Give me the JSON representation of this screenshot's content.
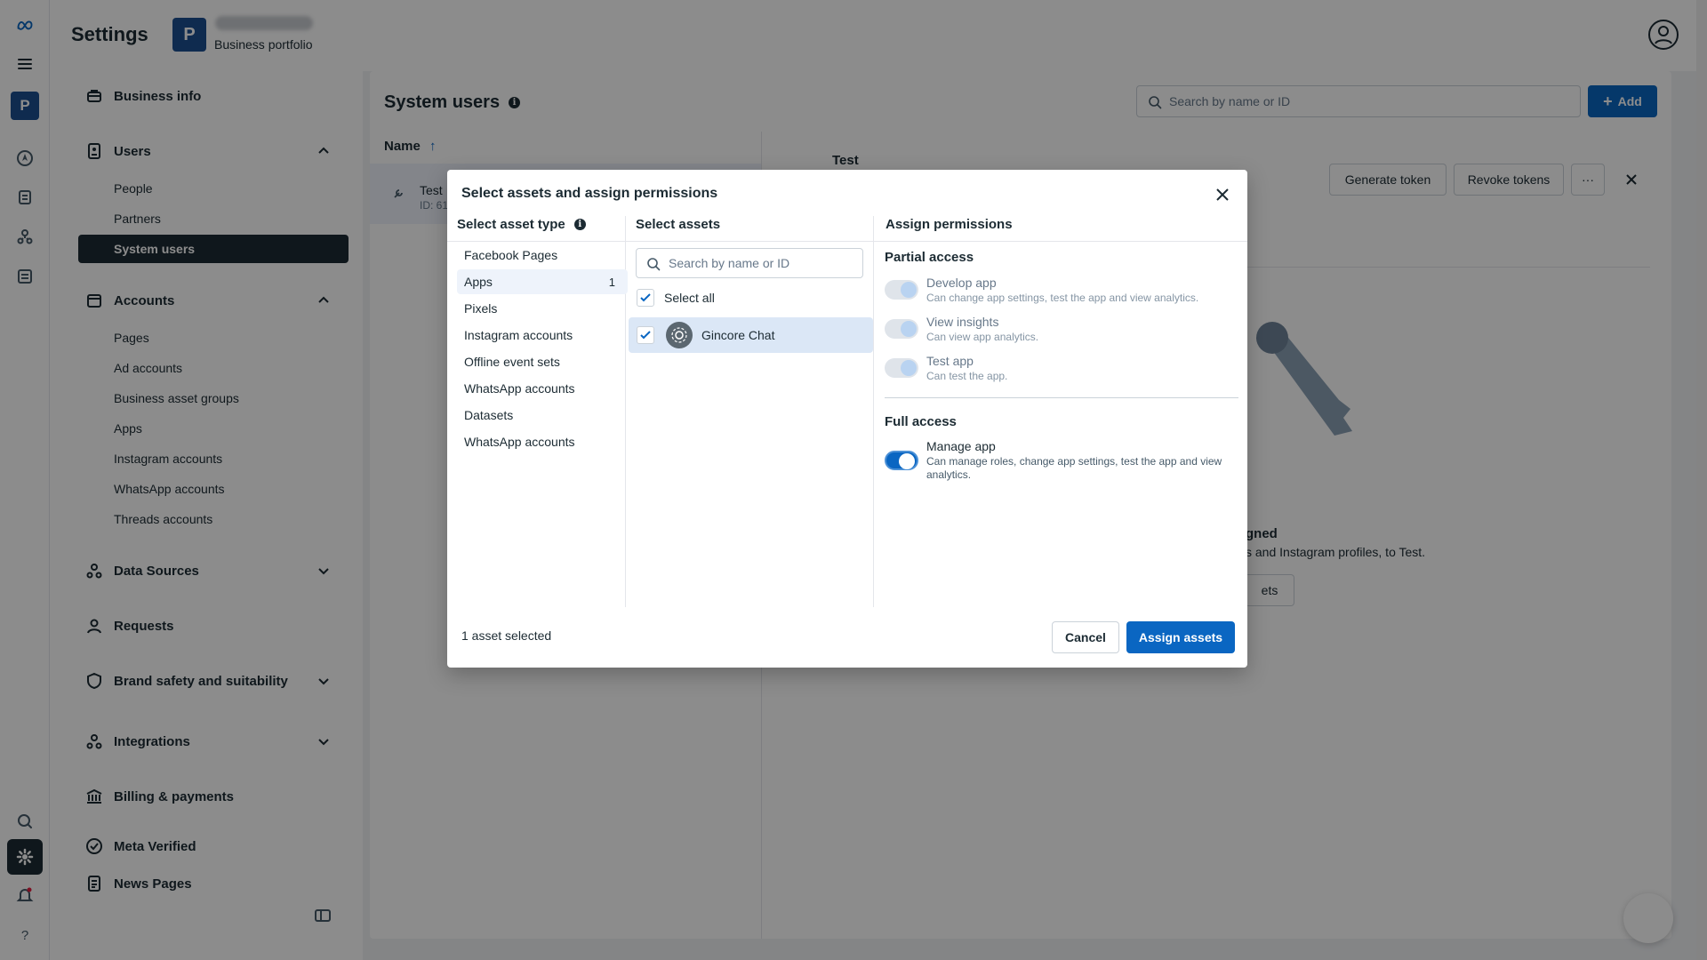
{
  "app": {
    "title": "Settings",
    "portfolio_initial": "P",
    "portfolio_label": "Business portfolio"
  },
  "rail": {
    "badge": "P",
    "items": [
      "meta-logo-icon",
      "menu-icon",
      "compass-icon",
      "pages-icon",
      "network-icon",
      "billing-icon",
      "search-icon",
      "gear-icon",
      "bell-icon",
      "help-icon"
    ]
  },
  "sidebar": {
    "business_info": "Business info",
    "users": "Users",
    "users_items": [
      "People",
      "Partners",
      "System users"
    ],
    "accounts": "Accounts",
    "accounts_items": [
      "Pages",
      "Ad accounts",
      "Business asset groups",
      "Apps",
      "Instagram accounts",
      "WhatsApp accounts",
      "Threads accounts"
    ],
    "data_sources": "Data Sources",
    "requests": "Requests",
    "brand_safety": "Brand safety and suitability",
    "integrations": "Integrations",
    "billing": "Billing & payments",
    "meta_verified": "Meta Verified",
    "news_pages": "News Pages"
  },
  "content": {
    "section_title": "System users",
    "search_placeholder": "Search by name or ID",
    "add_label": "Add",
    "col_name": "Name",
    "user_name": "Test",
    "user_id": "ID: 61",
    "detail_title": "Test",
    "generate_token": "Generate token",
    "revoke_tokens": "Revoke tokens",
    "more": "···",
    "empty_title": "gned",
    "empty_text": "s and Instagram profiles, to Test.",
    "empty_btn": "ets"
  },
  "modal": {
    "title": "Select assets and assign permissions",
    "col_asset_type": "Select asset type",
    "col_assets": "Select assets",
    "col_permissions": "Assign permissions",
    "asset_types": [
      {
        "label": "Facebook Pages",
        "count": ""
      },
      {
        "label": "Apps",
        "count": "1"
      },
      {
        "label": "Pixels",
        "count": ""
      },
      {
        "label": "Instagram accounts",
        "count": ""
      },
      {
        "label": "Offline event sets",
        "count": ""
      },
      {
        "label": "WhatsApp accounts",
        "count": ""
      },
      {
        "label": "Datasets",
        "count": ""
      },
      {
        "label": "WhatsApp accounts",
        "count": ""
      }
    ],
    "asset_search_placeholder": "Search by name or ID",
    "select_all": "Select all",
    "asset_name": "Gincore Chat",
    "partial_access": "Partial access",
    "full_access": "Full access",
    "perms": {
      "develop": {
        "name": "Develop app",
        "desc": "Can change app settings, test the app and view analytics.",
        "on": false
      },
      "insights": {
        "name": "View insights",
        "desc": "Can view app analytics.",
        "on": false
      },
      "test": {
        "name": "Test app",
        "desc": "Can test the app.",
        "on": false
      },
      "manage": {
        "name": "Manage app",
        "desc": "Can manage roles, change app settings, test the app and view analytics.",
        "on": true
      }
    },
    "footer_text": "1 asset selected",
    "cancel": "Cancel",
    "assign": "Assign assets"
  },
  "colors": {
    "primary": "#0a66c2",
    "text": "#1c2b33",
    "badge": "#1d4f91"
  }
}
